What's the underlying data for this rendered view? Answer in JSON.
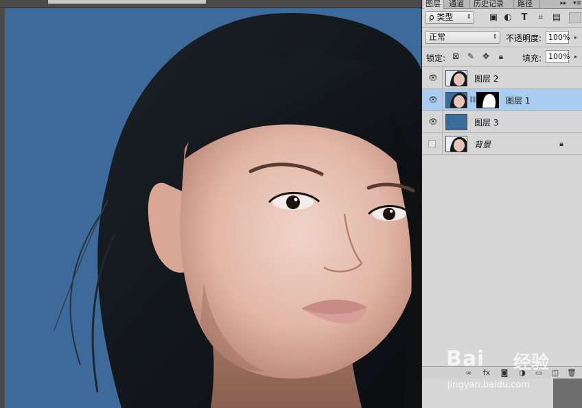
{
  "panel": {
    "tabs": [
      {
        "label": "图层"
      },
      {
        "label": "通道"
      },
      {
        "label": "历史记录"
      },
      {
        "label": "路径"
      }
    ],
    "more_glyph": "▸▸",
    "menu_glyph": "▾≡"
  },
  "filter": {
    "kind_label": "ρ 类型",
    "icons": [
      "image-filter-icon",
      "adjustment-filter-icon",
      "type-filter-icon",
      "shape-filter-icon",
      "smart-object-filter-icon"
    ]
  },
  "blend": {
    "mode": "正常",
    "opacity_label": "不透明度:",
    "opacity_value": "100%"
  },
  "lock": {
    "label": "锁定:",
    "fill_label": "填充:",
    "fill_value": "100%"
  },
  "layers": [
    {
      "name": "图层 2",
      "visible": true,
      "selected": false,
      "has_mask": false,
      "thumb": "photo"
    },
    {
      "name": "图层 1",
      "visible": true,
      "selected": true,
      "has_mask": true,
      "thumb": "photo"
    },
    {
      "name": "图层 3",
      "visible": true,
      "selected": false,
      "has_mask": false,
      "thumb": "solid",
      "color": "#3a6b9d"
    },
    {
      "name": "背景",
      "visible": false,
      "selected": false,
      "has_mask": false,
      "thumb": "photo",
      "locked": true
    }
  ],
  "colors": {
    "canvas_background": "#3d6a9b",
    "selected_row": "#a9cdf1",
    "panel_bg": "#d6d6d6"
  },
  "watermark": {
    "logo": "Bai",
    "logo_suffix": "经验",
    "url": "jingyan.baidu.com"
  }
}
